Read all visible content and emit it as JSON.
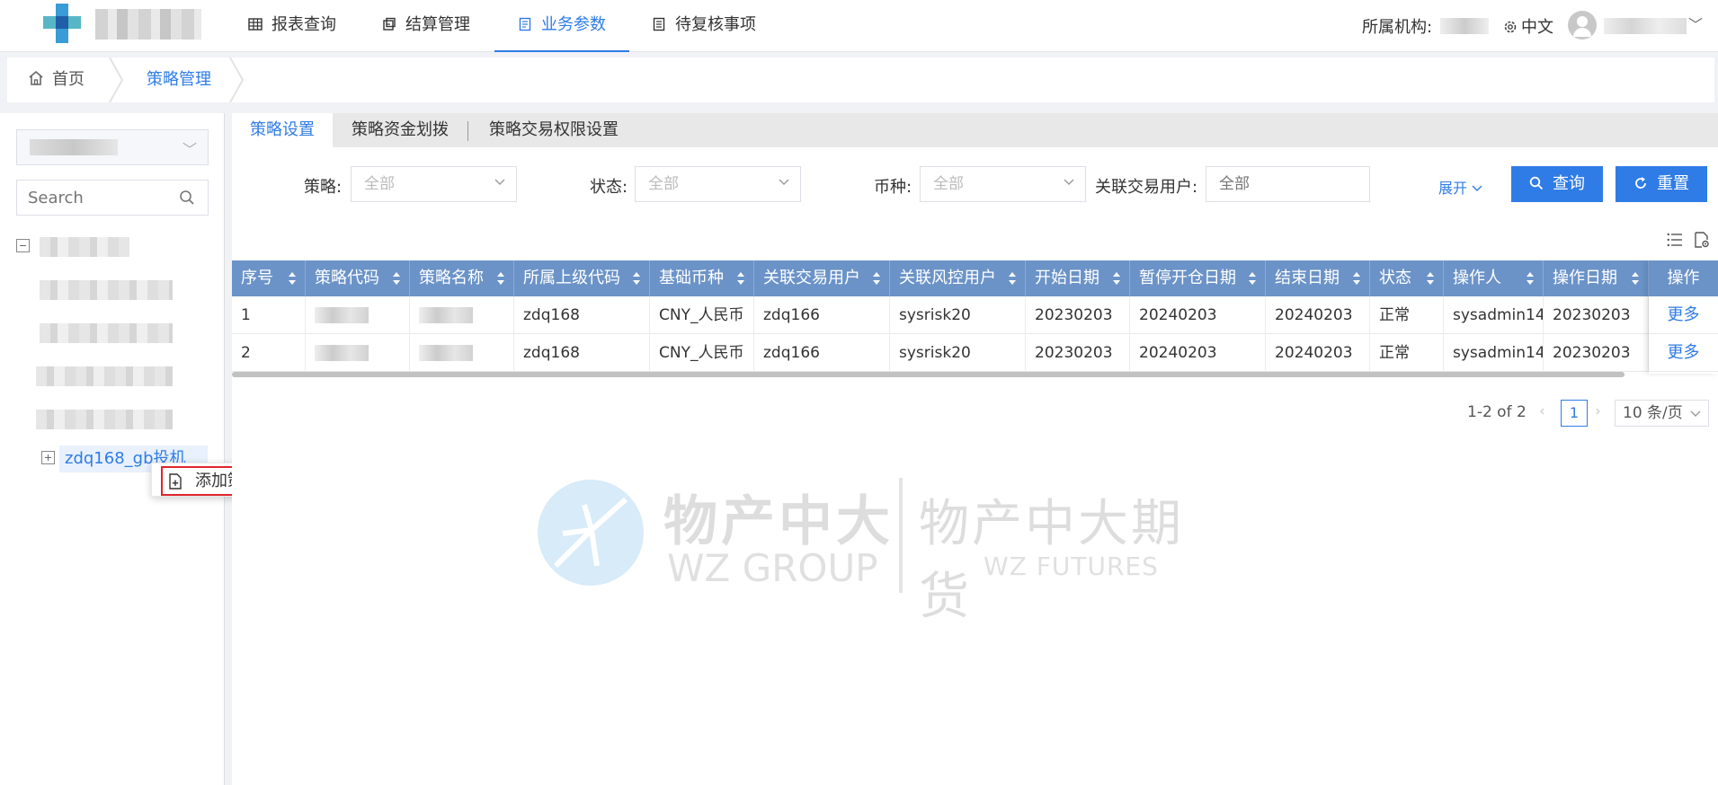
{
  "topnav": {
    "items": [
      {
        "label": "报表查询",
        "icon": "table-icon"
      },
      {
        "label": "结算管理",
        "icon": "settlement-icon"
      },
      {
        "label": "业务参数",
        "icon": "document-icon",
        "active": true
      },
      {
        "label": "待复核事项",
        "icon": "review-icon"
      }
    ],
    "org_label": "所属机构:",
    "lang_label": "中文"
  },
  "breadcrumb": {
    "home": "首页",
    "current": "策略管理"
  },
  "tree": {
    "search_placeholder": "Search",
    "selected_node": "zdq168_gb投机"
  },
  "context_menu": {
    "add_strategy": "添加策略"
  },
  "tabs": [
    {
      "label": "策略设置",
      "active": true
    },
    {
      "label": "策略资金划拨"
    },
    {
      "label": "策略交易权限设置"
    }
  ],
  "filters": {
    "strategy_label": "策略:",
    "strategy_value": "全部",
    "status_label": "状态:",
    "status_value": "全部",
    "currency_label": "币种:",
    "currency_value": "全部",
    "user_label": "关联交易用户:",
    "user_placeholder": "全部",
    "expand_label": "展开",
    "query_button": "查询",
    "reset_button": "重置"
  },
  "table": {
    "columns": [
      "序号",
      "策略代码",
      "策略名称",
      "所属上级代码",
      "基础币种",
      "关联交易用户",
      "关联风控用户",
      "开始日期",
      "暂停开仓日期",
      "结束日期",
      "状态",
      "操作人",
      "操作日期"
    ],
    "action_column": "操作",
    "rows": [
      [
        "1",
        "",
        "",
        "zdq168",
        "CNY_人民币",
        "zdq166",
        "sysrisk20",
        "20230203",
        "20240203",
        "20240203",
        "正常",
        "sysadmin14",
        "20230203"
      ],
      [
        "2",
        "",
        "",
        "zdq168",
        "CNY_人民币",
        "zdq166",
        "sysrisk20",
        "20230203",
        "20240203",
        "20240203",
        "正常",
        "sysadmin14",
        "20230203"
      ]
    ],
    "row_action": "更多"
  },
  "pagination": {
    "total": "1-2 of 2",
    "current_page": "1",
    "page_size": "10 条/页"
  },
  "watermark": {
    "cn_short": "物产中大",
    "en_group": "WZ GROUP",
    "cn_full": "物产中大期货",
    "en_futures": "WZ FUTURES"
  },
  "colors": {
    "accent": "#2f7ce6",
    "table_header": "#6b93c8",
    "highlight_border": "#e0242b"
  }
}
